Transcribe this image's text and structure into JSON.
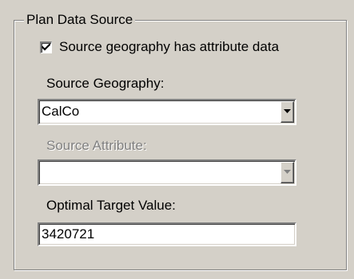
{
  "group": {
    "title": "Plan Data Source"
  },
  "checkbox": {
    "label": "Source geography has attribute data",
    "checked": true
  },
  "source_geography": {
    "label": "Source Geography:",
    "value": "CalCo"
  },
  "source_attribute": {
    "label": "Source Attribute:",
    "value": "",
    "enabled": false
  },
  "optimal_target": {
    "label": "Optimal Target Value:",
    "value": "3420721"
  },
  "icons": {
    "check": "check-mark-icon",
    "dropdown": "chevron-down-icon"
  },
  "colors": {
    "dialog_face": "#d4d0c8",
    "disabled_text": "#808080"
  }
}
